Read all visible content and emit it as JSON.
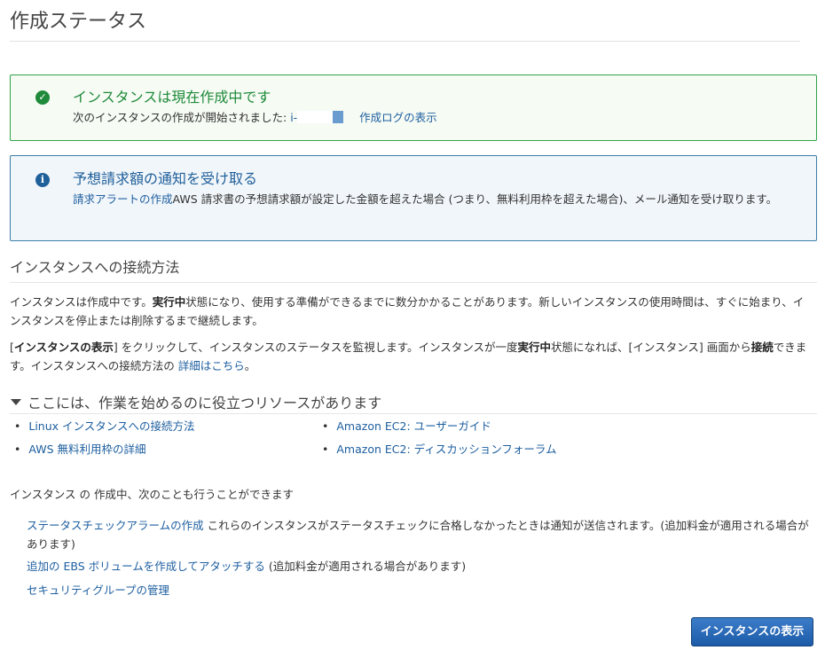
{
  "page": {
    "title": "作成ステータス"
  },
  "success_alert": {
    "icon": "check-circle-icon",
    "color": "#1f8a3a",
    "heading": "インスタンスは現在作成中です",
    "body_prefix": "次のインスタンスの作成が開始されました: ",
    "instance_id": "i-",
    "log_link": "作成ログの表示"
  },
  "info_alert": {
    "icon": "info-circle-icon",
    "color": "#1f5f9a",
    "heading": "予想請求額の通知を受け取る",
    "link": "請求アラートの作成",
    "body": "AWS 請求書の予想請求額が設定した金額を超えた場合 (つまり、無料利用枠を超えた場合)、メール通知を受け取ります。"
  },
  "connect": {
    "heading": "インスタンスへの接続方法",
    "p1_a": "インスタンスは作成中です。",
    "p1_b": "実行中",
    "p1_c": "状態になり、使用する準備ができるまでに数分かかることがあります。新しいインスタンスの使用時間は、すぐに始まり、インスタンスを停止または削除するまで継続します。",
    "p2_a": "[",
    "p2_b": "インスタンスの表示",
    "p2_c": "] をクリックして、インスタンスのステータスを監視します。インスタンスが一度",
    "p2_d": "実行中",
    "p2_e": "状態になれば、[インスタンス] 画面から",
    "p2_f": "接続",
    "p2_g": "できます。インスタンスへの接続方法の ",
    "p2_link": "詳細はこちら",
    "p2_h": "。"
  },
  "resources": {
    "heading": "ここには、作業を始めるのに役立つリソースがあります",
    "items": [
      "Linux インスタンスへの接続方法",
      "Amazon EC2: ユーザーガイド",
      "AWS 無料利用枠の詳細",
      "Amazon EC2: ディスカッションフォーラム"
    ]
  },
  "extras": {
    "intro": "インスタンス の 作成中、次のことも行うことができます",
    "item1_link": "ステータスチェックアラームの作成",
    "item1_text": " これらのインスタンスがステータスチェックに合格しなかったときは通知が送信されます。(追加料金が適用される場合があります)",
    "item2_link": "追加の EBS ボリュームを作成してアタッチする",
    "item2_text": " (追加料金が適用される場合があります)",
    "item3_link": "セキュリティグループの管理"
  },
  "actions": {
    "view_instances": "インスタンスの表示",
    "button_color": "#1d5ba8"
  }
}
